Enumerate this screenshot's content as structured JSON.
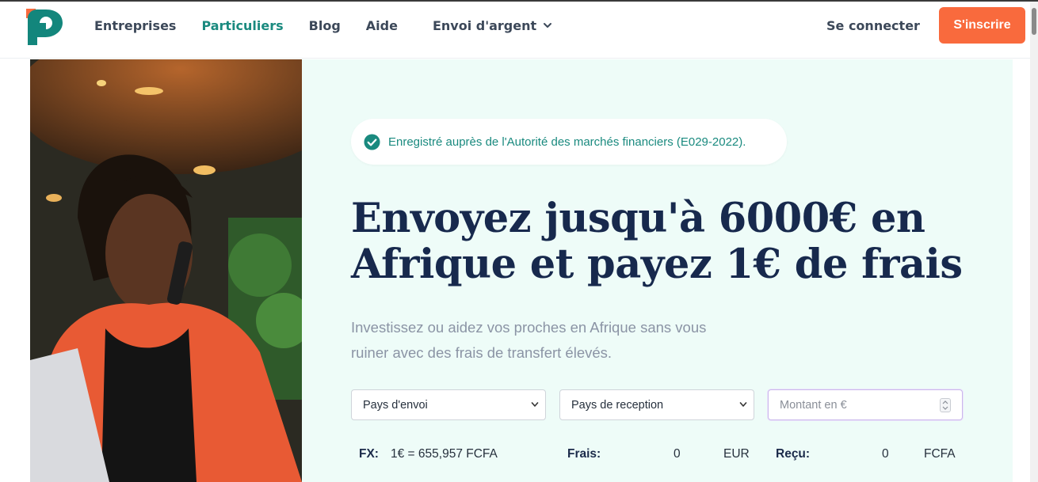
{
  "header": {
    "nav": [
      {
        "label": "Entreprises",
        "active": false
      },
      {
        "label": "Particuliers",
        "active": true
      },
      {
        "label": "Blog",
        "active": false
      },
      {
        "label": "Aide",
        "active": false
      }
    ],
    "dropdown_label": "Envoi d'argent",
    "login_label": "Se connecter",
    "signup_label": "S'inscrire"
  },
  "hero": {
    "badge_text": "Enregistré auprès de l'Autorité des marchés financiers (E029-2022).",
    "title_line1": "Envoyez jusqu'à 6000€ en",
    "title_line2": "Afrique et payez 1€ de frais",
    "subtitle_line1": "Investissez ou aidez vos proches en Afrique sans vous",
    "subtitle_line2": "ruiner avec des frais de transfert élevés."
  },
  "form": {
    "send_country": "Pays d'envoi",
    "receive_country": "Pays de reception",
    "amount_placeholder": "Montant en €"
  },
  "summary": {
    "fx_label": "FX:",
    "fx_value": "1€ = 655,957 FCFA",
    "fees_label": "Frais:",
    "fees_value": "0",
    "fees_currency": "EUR",
    "received_label": "Reçu:",
    "received_value": "0",
    "received_currency": "FCFA"
  },
  "colors": {
    "brand_teal": "#1a8a7f",
    "accent_orange": "#f96a3d",
    "navy": "#17294d",
    "hero_bg": "#eefcf8"
  }
}
